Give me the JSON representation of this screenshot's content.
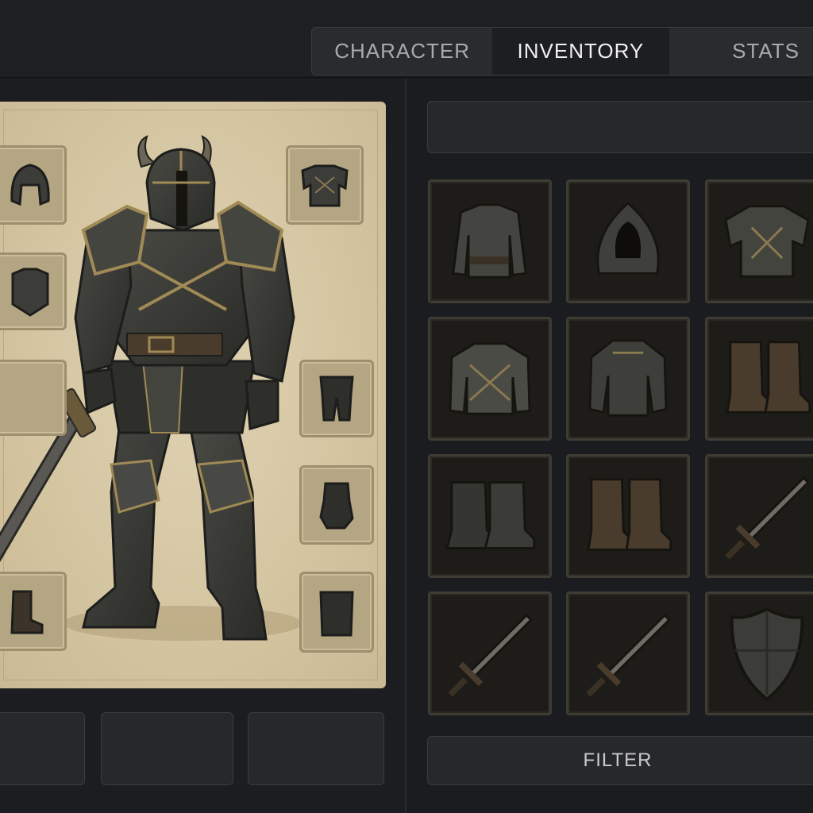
{
  "tabs": [
    {
      "label": "CHARACTER",
      "active": false
    },
    {
      "label": "INVENTORY",
      "active": true
    },
    {
      "label": "STATS",
      "active": false
    }
  ],
  "equipment": {
    "slots": [
      {
        "item": "helmet-icon"
      },
      {
        "item": "breastplate-icon"
      },
      {
        "item": "cuirass-icon"
      },
      {
        "item": "empty"
      },
      {
        "item": "leggings-icon"
      },
      {
        "item": "gauntlet-icon"
      },
      {
        "item": "boots-icon"
      },
      {
        "item": "boots-icon"
      }
    ]
  },
  "inventory": {
    "search": {
      "value": "",
      "placeholder": ""
    },
    "items": [
      "leather-tunic-icon",
      "hood-icon",
      "breastplate-icon",
      "tunic-icon",
      "chestplate-icon",
      "leather-boots-icon",
      "iron-boots-icon",
      "leather-boots-icon",
      "sword-icon",
      "sword-icon",
      "sword-icon",
      "shield-icon"
    ]
  },
  "filter": {
    "label": "FILTER"
  },
  "colors": {
    "background": "#1b1c1f",
    "parchment": "#d8caa6",
    "armor": "#3a3a36",
    "trim": "#a08a55",
    "slot": "#1d1c18"
  }
}
